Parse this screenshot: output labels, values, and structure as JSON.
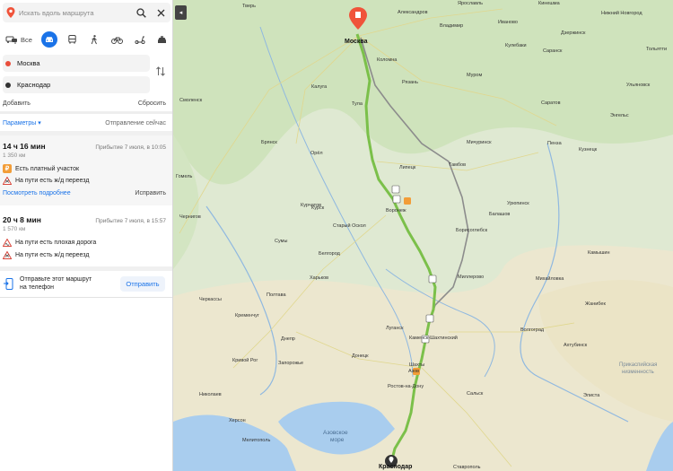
{
  "search": {
    "placeholder": "Искать вдоль маршрута"
  },
  "modes": [
    {
      "name": "all",
      "label": "Все"
    },
    {
      "name": "car"
    },
    {
      "name": "transit"
    },
    {
      "name": "walk"
    },
    {
      "name": "bicycle"
    },
    {
      "name": "scooter"
    },
    {
      "name": "taxi"
    }
  ],
  "waypoints": {
    "from": "Москва",
    "to": "Краснодар"
  },
  "actions": {
    "add": "Добавить",
    "reset": "Сбросить"
  },
  "params": {
    "label": "Параметры ▾",
    "departure": "Отправление сейчас"
  },
  "routes": [
    {
      "time": "14 ч 16 мин",
      "arrival": "Прибытие 7 июля, в 10:05",
      "distance": "1 350 км",
      "warnings": [
        "Есть платный участок",
        "На пути есть ж/д переезд"
      ],
      "details_link": "Посмотреть подробнее",
      "fix": "Исправить"
    },
    {
      "time": "20 ч 8 мин",
      "arrival": "Прибытие 7 июля, в 15:57",
      "distance": "1 570 км",
      "warnings": [
        "На пути есть плохая дорога",
        "На пути есть ж/д переезд"
      ]
    }
  ],
  "send": {
    "text_line1": "Отправьте этот маршрут",
    "text_line2": "на телефон",
    "button": "Отправить"
  },
  "map": {
    "cities_big": [
      "Москва",
      "Краснодар"
    ],
    "cities": [
      "Тверь",
      "Ярославль",
      "Иваново",
      "Нижний Новгород",
      "Владимир",
      "Рязань",
      "Калуга",
      "Тула",
      "Брянск",
      "Орёл",
      "Липецк",
      "Тамбов",
      "Пенза",
      "Саратов",
      "Курск",
      "Воронеж",
      "Белгород",
      "Старый Оскол",
      "Сумы",
      "Харьков",
      "Полтава",
      "Борисоглебск",
      "Балашов",
      "Камышин",
      "Волгоград",
      "Кременчуг",
      "Днепр",
      "Донецк",
      "Запорожье",
      "Кривой Рог",
      "Луганск",
      "Каменск-Шахтинский",
      "Шахты",
      "Ростов-на-Дону",
      "Элиста",
      "Николаев",
      "Херсон",
      "Ставрополь",
      "Черкассы",
      "Чернигов",
      "Миллерово",
      "Урюпинск",
      "Ульяновск",
      "Смоленск",
      "Гомель",
      "Тольятти",
      "Саранск",
      "Коломна",
      "Кулебаки",
      "Кузнецк",
      "Мичуринск",
      "Михайловка",
      "Курчатов",
      "Мелитополь",
      "Азов",
      "Сальск",
      "Жанибек",
      "Ахтубинск",
      "Энгельс",
      "Александров",
      "Кинешма",
      "Муром",
      "Дзержинск"
    ],
    "sea_label": [
      "Азовское",
      "море"
    ],
    "region_label": [
      "Прикаспийская",
      "низменность"
    ]
  },
  "colors": {
    "route_main": "#7bc04a",
    "route_alt": "#8c8c8c",
    "accent": "#1a73e8",
    "pin": "#f0533a"
  }
}
